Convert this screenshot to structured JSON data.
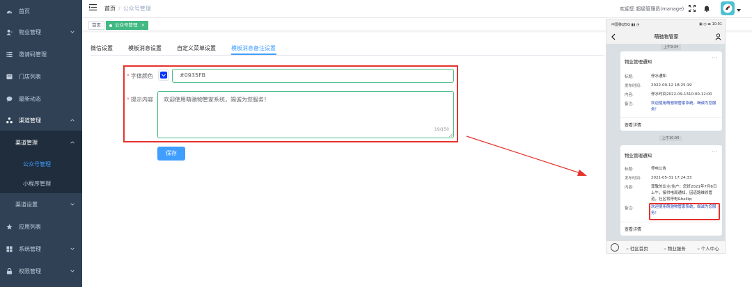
{
  "sidebar": {
    "items": [
      {
        "label": "首页",
        "icon": "dashboard-icon"
      },
      {
        "label": "物业管理",
        "icon": "user-icon",
        "has_children": true
      },
      {
        "label": "邀请码管理",
        "icon": "list-icon"
      },
      {
        "label": "门店列表",
        "icon": "store-icon"
      },
      {
        "label": "最新动态",
        "icon": "chat-icon"
      },
      {
        "label": "渠道管理",
        "icon": "channel-icon",
        "has_children": true,
        "expanded": true
      },
      {
        "label": "应用列表",
        "icon": "star-icon"
      },
      {
        "label": "系统管理",
        "icon": "grid-icon",
        "has_children": true
      },
      {
        "label": "权限管理",
        "icon": "lock-icon",
        "has_children": true
      }
    ],
    "channel_submenu": {
      "group": "渠道管理",
      "children": [
        "公众号管理",
        "小程序管理"
      ],
      "active": "公众号管理",
      "settings": "渠道设置"
    }
  },
  "navbar": {
    "breadcrumb": [
      "首页",
      "公众号管理"
    ],
    "welcome": "欢迎您 超级管理员(manage)"
  },
  "tags": [
    {
      "label": "首页"
    },
    {
      "label": "公众号管理",
      "active": true,
      "close": "×"
    }
  ],
  "tabs": {
    "items": [
      "微信设置",
      "模板消息设置",
      "自定义菜单设置",
      "模板消息备注设置"
    ],
    "active": "模板消息备注设置"
  },
  "form": {
    "font_color_label": "字体颜色",
    "font_color_value": "#0935FB",
    "tip_content_label": "提示内容",
    "tip_content_value": "欢迎使用萌驰物管家系统，竭诚为您服务！",
    "counter": "19/150",
    "save_label": "保存",
    "required_mark": "*"
  },
  "phone": {
    "status_left": "中国移动5G ▮▮ ◔",
    "status_right": "▣ ◷ ▬ 10:01",
    "title": "萌驰物管家",
    "time_top": "上午9:34",
    "time_mid": "上午10:00",
    "card1": {
      "title": "物业管理通知",
      "rows": [
        {
          "k": "标题:",
          "v": "停水通知"
        },
        {
          "k": "发布时间:",
          "v": "2022-09-12 18:25:19"
        },
        {
          "k": "内容:",
          "v": "停水时间2022-09-1310:00-12:00"
        },
        {
          "k": "备注:",
          "v": "欢迎使用萌驰物管家系统，竭诚为您服务！"
        }
      ],
      "footer": "查看详情"
    },
    "card2": {
      "title": "物业管理通知",
      "rows": [
        {
          "k": "标题:",
          "v": "停电公告"
        },
        {
          "k": "发布时间:",
          "v": "2021-05-31 17:24:33"
        },
        {
          "k": "内容:",
          "v": "尊敬的业主/住户：您好2021年7月6日上午，接供电局通知，因道路维修管道，社区将停电&hellip;"
        },
        {
          "k": "备注:",
          "v": "欢迎使用萌驰物管家系统，竭诚为您服务！"
        }
      ],
      "footer": "查看详情"
    },
    "tabbar": [
      "社区首页",
      "物业服务",
      "个人中心"
    ]
  },
  "colors": {
    "sidebar_bg": "#304156",
    "accent": "#409eff",
    "tag_active": "#42b983",
    "font_color_swatch": "#0935FB",
    "highlight_red": "#e5322d"
  }
}
